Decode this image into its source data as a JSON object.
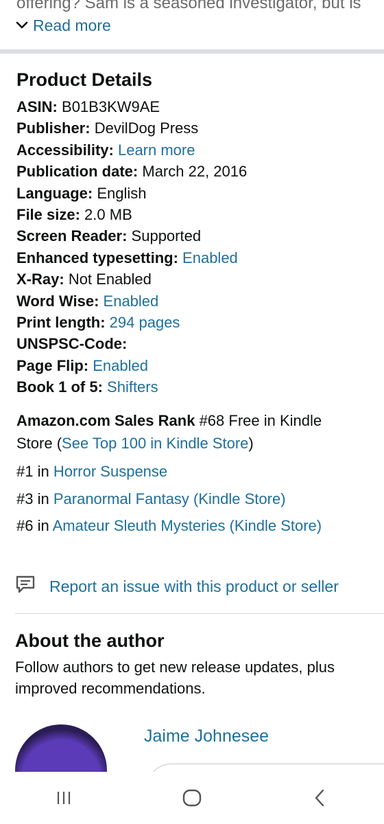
{
  "description": {
    "snippet": "offering? Sam is a seasoned investigator, but is",
    "read_more_label": "Read more"
  },
  "product_details": {
    "title": "Product Details",
    "rows": [
      {
        "label": "ASIN:",
        "value": "B01B3KW9AE",
        "link": false
      },
      {
        "label": "Publisher:",
        "value": "DevilDog Press",
        "link": false
      },
      {
        "label": "Accessibility:",
        "value": "Learn more",
        "link": true
      },
      {
        "label": "Publication date:",
        "value": "March 22, 2016",
        "link": false
      },
      {
        "label": "Language:",
        "value": "English",
        "link": false
      },
      {
        "label": "File size:",
        "value": "2.0 MB",
        "link": false
      },
      {
        "label": "Screen Reader:",
        "value": "Supported",
        "link": false
      },
      {
        "label": "Enhanced typesetting:",
        "value": "Enabled",
        "link": true
      },
      {
        "label": "X-Ray:",
        "value": "Not Enabled",
        "link": false
      },
      {
        "label": "Word Wise:",
        "value": "Enabled",
        "link": true
      },
      {
        "label": "Print length:",
        "value": "294 pages",
        "link": true
      },
      {
        "label": "UNSPSC-Code:",
        "value": "",
        "link": false
      },
      {
        "label": "Page Flip:",
        "value": "Enabled",
        "link": true
      },
      {
        "label": "Book 1 of 5:",
        "value": "Shifters",
        "link": true
      }
    ]
  },
  "sales_rank": {
    "label": "Amazon.com Sales Rank",
    "text": "#68 Free in Kindle",
    "text2": "Store (",
    "top_link": "See Top 100 in Kindle Store",
    "close_paren": ")",
    "categories": [
      {
        "rank": "#1 in",
        "name": "Horror Suspense"
      },
      {
        "rank": "#3 in",
        "name": "Paranormal Fantasy (Kindle Store)"
      },
      {
        "rank": "#6 in",
        "name": "Amateur Sleuth Mysteries (Kindle Store)"
      }
    ]
  },
  "report": {
    "icon": "feedback-icon",
    "label": "Report an issue with this product or seller"
  },
  "about_author": {
    "title": "About the author",
    "line1": "Follow authors to get new release updates, plus",
    "line2": "improved recommendations.",
    "author_name": "Jaime Johnesee"
  },
  "navbar": {
    "icons": [
      "recent-apps-icon",
      "home-icon",
      "back-icon"
    ]
  },
  "colors": {
    "link": "#1f6f9c",
    "text": "#0f1111",
    "divider": "#dcdde0"
  }
}
